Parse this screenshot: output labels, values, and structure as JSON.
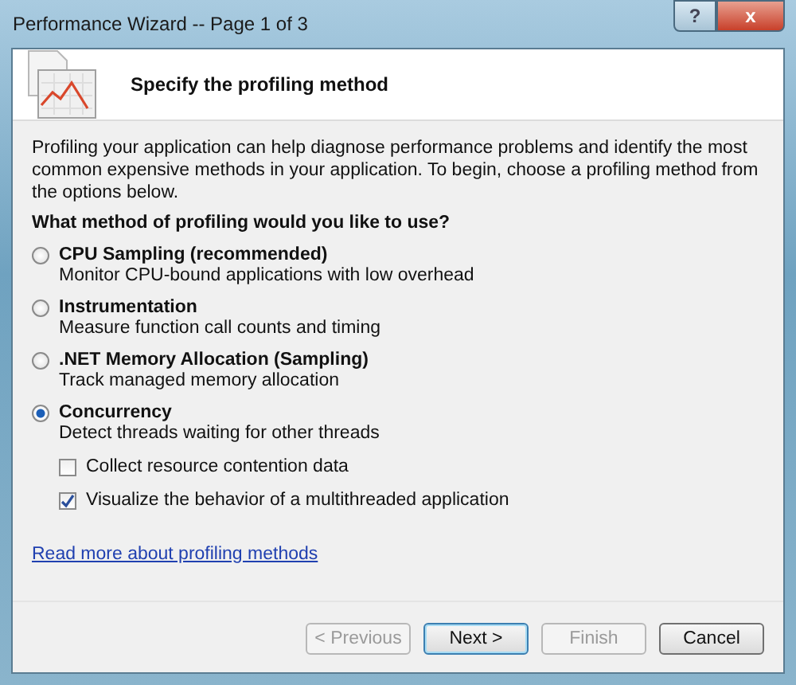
{
  "window": {
    "title": "Performance Wizard -- Page 1 of 3",
    "controls": [
      "?",
      "x"
    ]
  },
  "header": {
    "title": "Specify the profiling method"
  },
  "intro": "Profiling your application can help diagnose performance problems and identify the most common expensive methods in your application. To begin, choose a profiling method from the options below.",
  "question": "What method of profiling would you like to use?",
  "methods": [
    {
      "label": "CPU Sampling (recommended)",
      "description": "Monitor CPU-bound applications with low overhead",
      "selected": false
    },
    {
      "label": "Instrumentation",
      "description": "Measure function call counts and timing",
      "selected": false
    },
    {
      "label": ".NET Memory Allocation (Sampling)",
      "description": "Track managed memory allocation",
      "selected": false
    },
    {
      "label": "Concurrency",
      "description": "Detect threads waiting for other threads",
      "selected": true,
      "options": [
        {
          "label": "Collect resource contention data",
          "checked": false
        },
        {
          "label": "Visualize the behavior of a multithreaded application",
          "checked": true
        }
      ]
    }
  ],
  "link": "Read more about profiling methods",
  "buttons": [
    {
      "label": "< Previous",
      "disabled": true,
      "default": false
    },
    {
      "label": "Next >",
      "disabled": false,
      "default": true
    },
    {
      "label": "Finish",
      "disabled": true,
      "default": false
    },
    {
      "label": "Cancel",
      "disabled": false,
      "default": false
    }
  ]
}
